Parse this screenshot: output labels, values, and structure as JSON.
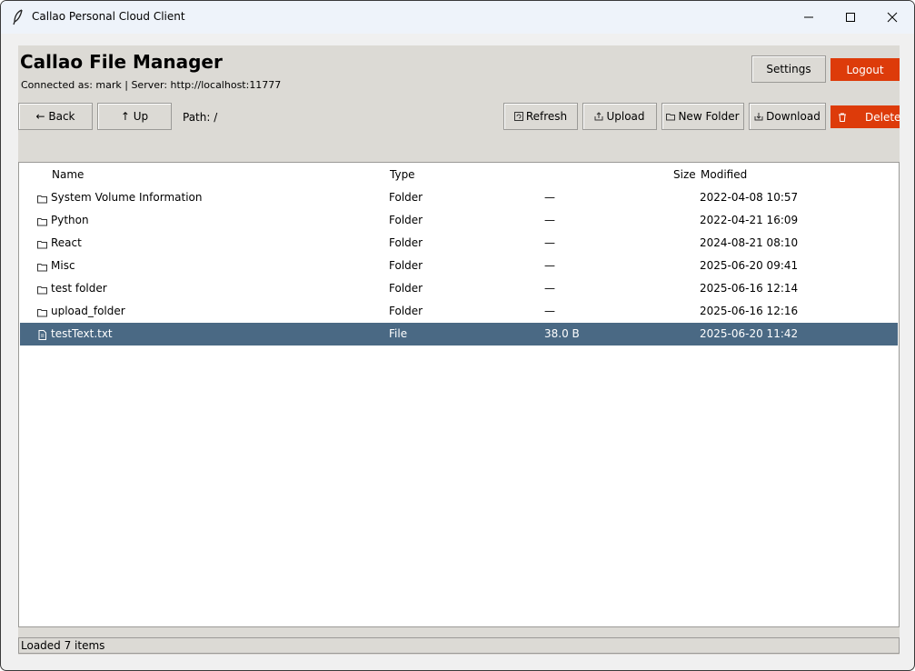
{
  "window": {
    "title": "Callao Personal Cloud Client"
  },
  "header": {
    "app_title": "Callao File Manager",
    "connection_info": "Connected as: mark | Server: http://localhost:11777",
    "settings_label": "Settings",
    "logout_label": "Logout"
  },
  "toolbar": {
    "back_label": "← Back",
    "up_label": "↑ Up",
    "path_label": "Path: /",
    "refresh_label": "Refresh",
    "upload_label": "Upload",
    "new_folder_label": "New Folder",
    "download_label": "Download",
    "delete_label": "Delete"
  },
  "table": {
    "columns": [
      "Name",
      "Type",
      "Size",
      "Modified"
    ],
    "rows": [
      {
        "name": "System Volume Information",
        "type": "Folder",
        "size": "—",
        "modified": "2022-04-08 10:57",
        "icon": "folder-icon"
      },
      {
        "name": "Python",
        "type": "Folder",
        "size": "—",
        "modified": "2022-04-21 16:09",
        "icon": "folder-icon"
      },
      {
        "name": "React",
        "type": "Folder",
        "size": "—",
        "modified": "2024-08-21 08:10",
        "icon": "folder-icon"
      },
      {
        "name": "Misc",
        "type": "Folder",
        "size": "—",
        "modified": "2025-06-20 09:41",
        "icon": "folder-icon"
      },
      {
        "name": "test folder",
        "type": "Folder",
        "size": "—",
        "modified": "2025-06-16 12:14",
        "icon": "folder-icon"
      },
      {
        "name": "upload_folder",
        "type": "Folder",
        "size": "—",
        "modified": "2025-06-16 12:16",
        "icon": "folder-icon"
      },
      {
        "name": "testText.txt",
        "type": "File",
        "size": "38.0 B",
        "modified": "2025-06-20 11:42",
        "icon": "file-icon",
        "selected": true
      }
    ]
  },
  "status": {
    "text": "Loaded 7 items"
  },
  "colors": {
    "accent_red": "#dd3b0a",
    "selection": "#4a6984",
    "panel_bg": "#dcdad5"
  }
}
